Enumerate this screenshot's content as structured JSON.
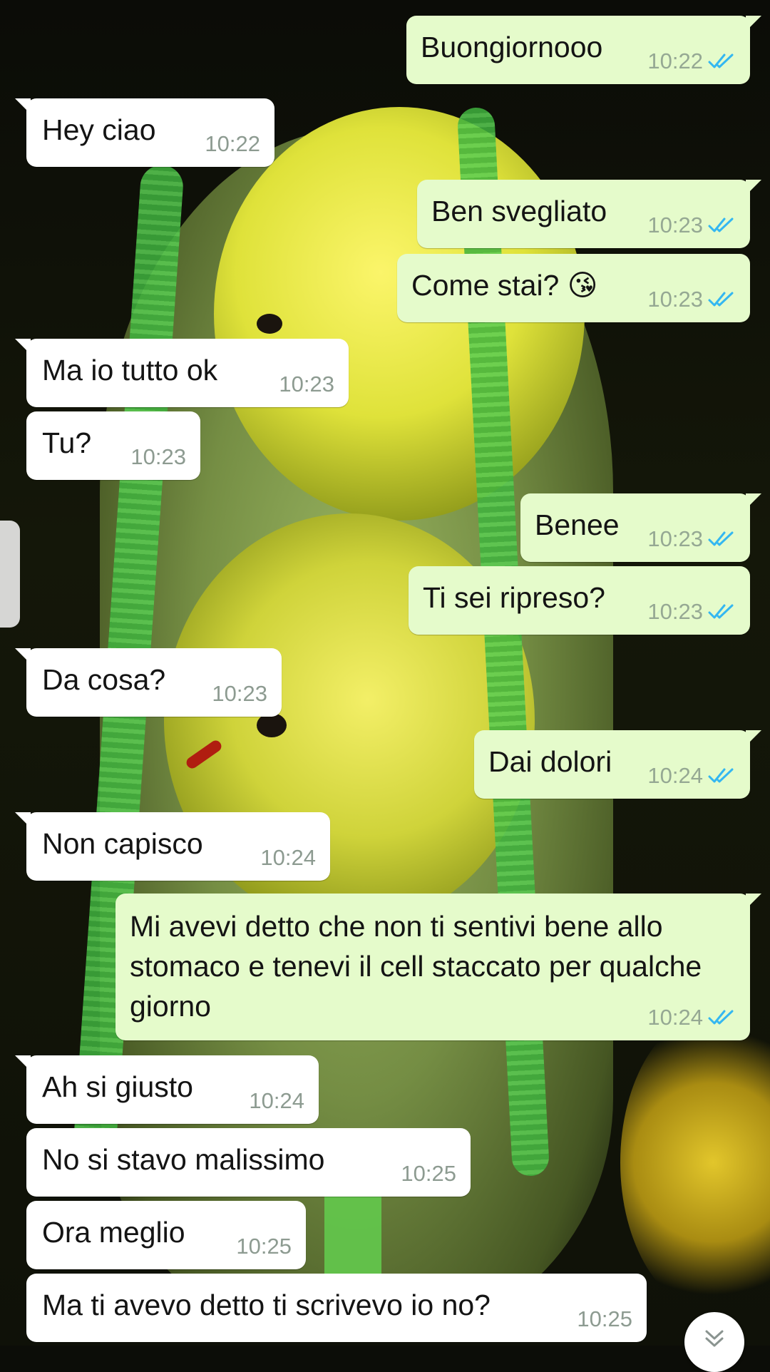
{
  "messages": [
    {
      "dir": "out",
      "text": "Buongiornooo",
      "time": "10:22",
      "read": true
    },
    {
      "dir": "in",
      "text": "Hey ciao",
      "time": "10:22"
    },
    {
      "dir": "out",
      "text": "Ben svegliato",
      "time": "10:23",
      "read": true
    },
    {
      "dir": "out",
      "text": "Come stai? 😘",
      "time": "10:23",
      "read": true
    },
    {
      "dir": "in",
      "text": "Ma io tutto ok",
      "time": "10:23"
    },
    {
      "dir": "in",
      "text": "Tu?",
      "time": "10:23"
    },
    {
      "dir": "out",
      "text": "Benee",
      "time": "10:23",
      "read": true
    },
    {
      "dir": "out",
      "text": "Ti sei ripreso?",
      "time": "10:23",
      "read": true
    },
    {
      "dir": "in",
      "text": "Da cosa?",
      "time": "10:23"
    },
    {
      "dir": "out",
      "text": "Dai dolori",
      "time": "10:24",
      "read": true
    },
    {
      "dir": "in",
      "text": "Non capisco",
      "time": "10:24"
    },
    {
      "dir": "out",
      "text": "Mi avevi detto che non ti sentivi bene allo stomaco e tenevi il cell staccato per qualche giorno",
      "time": "10:24",
      "read": true
    },
    {
      "dir": "in",
      "text": "Ah si giusto",
      "time": "10:24"
    },
    {
      "dir": "in",
      "text": "No si stavo malissimo",
      "time": "10:25"
    },
    {
      "dir": "in",
      "text": "Ora meglio",
      "time": "10:25"
    },
    {
      "dir": "in",
      "text": "Ma ti avevo detto ti scrivevo io no?",
      "time": "10:25"
    }
  ],
  "colors": {
    "incoming_bubble": "#ffffff",
    "outgoing_bubble": "#e5fbcb",
    "read_tick": "#34b7f1",
    "timestamp": "#8d9b91"
  },
  "icons": {
    "read_receipt": "double-check-icon",
    "scroll_down": "chevron-double-down-icon"
  }
}
